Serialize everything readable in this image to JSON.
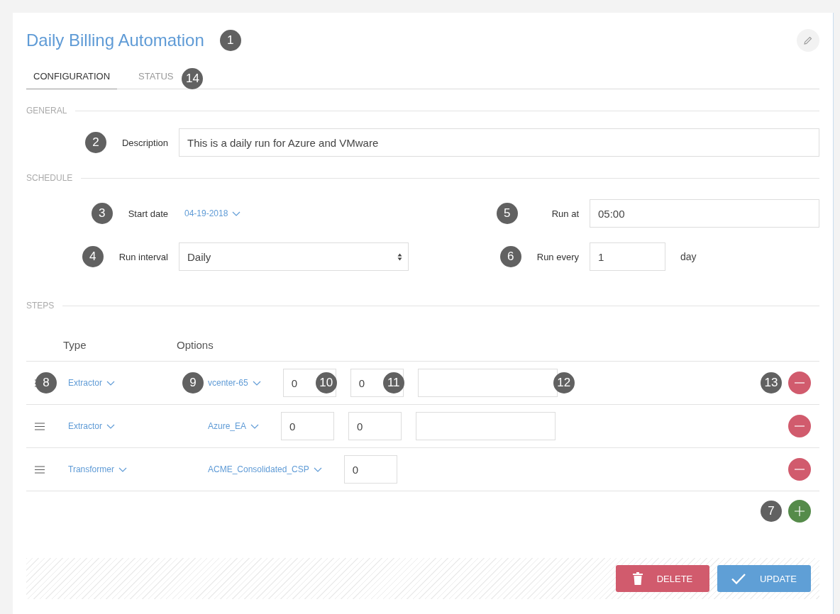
{
  "title": {
    "text": "Daily Billing Automation",
    "badge": "1"
  },
  "tabs": [
    {
      "label": "CONFIGURATION",
      "selected": true
    },
    {
      "label": "STATUS",
      "selected": false,
      "badge": "14"
    }
  ],
  "general": {
    "heading": "GENERAL",
    "description": {
      "label": "Description",
      "value": "This is a daily run for Azure and VMware",
      "badge": "2"
    }
  },
  "schedule": {
    "heading": "SCHEDULE",
    "start_date": {
      "label": "Start date",
      "value": "04-19-2018",
      "badge": "3"
    },
    "run_at": {
      "label": "Run at",
      "value": "05:00",
      "badge": "5"
    },
    "run_interval": {
      "label": "Run interval",
      "value": "Daily",
      "badge": "4"
    },
    "run_every": {
      "label": "Run every",
      "value": "1",
      "unit": "day",
      "badge": "6"
    }
  },
  "steps": {
    "heading": "STEPS",
    "columns": [
      "Type",
      "Options"
    ],
    "rows": [
      {
        "type": "Extractor",
        "option": "vcenter-65",
        "handle_badge": "8",
        "option_badge": "9",
        "remove_badge": "13",
        "fields": [
          {
            "kind": "short",
            "value": "0",
            "badge": "10"
          },
          {
            "kind": "short",
            "value": "0",
            "badge": "11"
          },
          {
            "kind": "long",
            "badge": "12"
          }
        ]
      },
      {
        "type": "Extractor",
        "option": "Azure_EA",
        "fields": [
          {
            "kind": "short",
            "value": "0"
          },
          {
            "kind": "short",
            "value": "0"
          },
          {
            "kind": "long"
          }
        ]
      },
      {
        "type": "Transformer",
        "option": "ACME_Consolidated_CSP",
        "fields": [
          {
            "kind": "short",
            "value": "0"
          }
        ]
      }
    ],
    "add_badge": "7"
  },
  "buttons": [
    {
      "kind": "delete",
      "label": "DELETE"
    },
    {
      "kind": "update",
      "label": "UPDATE"
    }
  ]
}
